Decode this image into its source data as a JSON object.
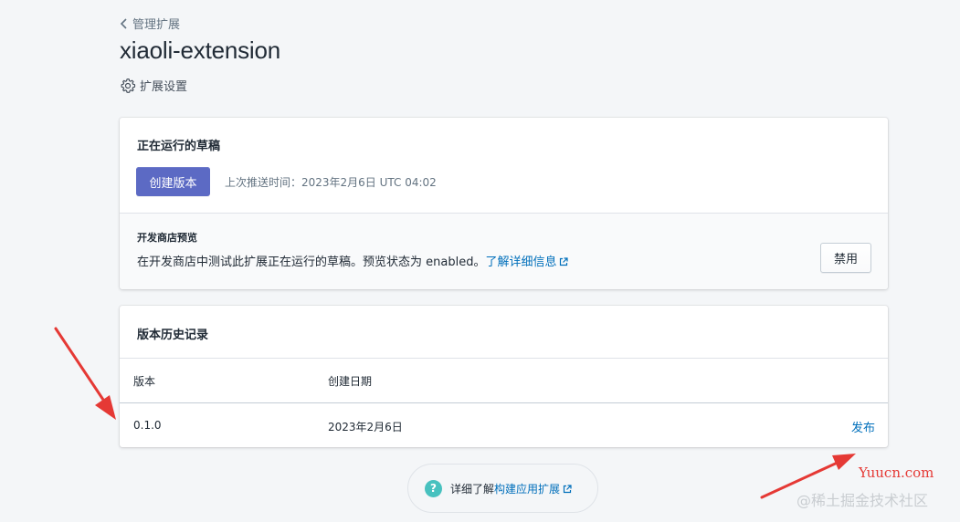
{
  "breadcrumb": {
    "label": "管理扩展"
  },
  "page": {
    "title": "xiaoli-extension",
    "settings_label": "扩展设置"
  },
  "draft_card": {
    "title": "正在运行的草稿",
    "create_version_label": "创建版本",
    "last_push": "上次推送时间：2023年2月6日 UTC 04:02",
    "preview": {
      "title": "开发商店预览",
      "description": "在开发商店中测试此扩展正在运行的草稿。预览状态为 enabled。",
      "learn_more": "了解详细信息",
      "disable_label": "禁用"
    }
  },
  "history_card": {
    "title": "版本历史记录",
    "columns": [
      "版本",
      "创建日期"
    ],
    "rows": [
      {
        "version": "0.1.0",
        "created": "2023年2月6日",
        "action": "发布"
      }
    ]
  },
  "footer": {
    "prefix": "详细了解",
    "link": "构建应用扩展"
  },
  "watermark": {
    "site": "Yuucn.com",
    "community": "@稀土掘金技术社区"
  },
  "colors": {
    "primary": "#5c6ac4",
    "link": "#006fbb",
    "annotation": "#e53935",
    "help": "#47c1bf"
  }
}
